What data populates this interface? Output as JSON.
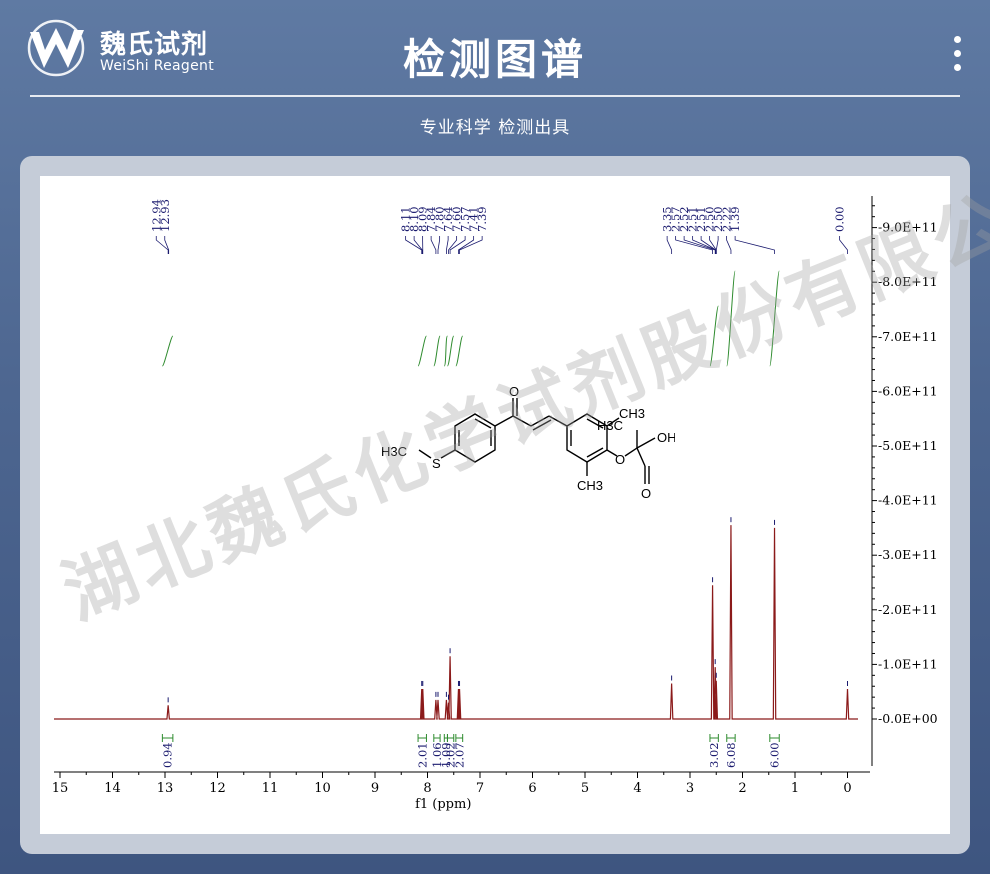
{
  "brand": {
    "name_cn": "魏氏试剂",
    "name_en": "WeiShi Reagent"
  },
  "header": {
    "title": "检测图谱",
    "subtitle": "专业科学  检测出具"
  },
  "watermark": "湖北魏氏化学试剂股份有限公司",
  "colors": {
    "spectrum": "#8b1a1a",
    "integral": "#2e8b2e",
    "peak_label": "#1a1a6e",
    "header_bg": "#4d6690"
  },
  "molecule_labels": {
    "h3c_s": "H3C",
    "s": "S",
    "o_ketone": "O",
    "h3c": "H3C",
    "ch3_top": "CH3",
    "ch3_bottom": "CH3",
    "o_ether": "O",
    "oh": "OH",
    "o_acid": "O"
  },
  "chart_data": {
    "type": "line",
    "title": "",
    "xlabel": "f1 (ppm)",
    "ylabel": "",
    "xlim": [
      15,
      -0.2
    ],
    "ylim": [
      -100000000000.0,
      950000000000.0
    ],
    "x_ticks": [
      "15",
      "14",
      "13",
      "12",
      "11",
      "10",
      "9",
      "8",
      "7",
      "6",
      "5",
      "4",
      "3",
      "2",
      "1",
      "0"
    ],
    "y_ticks": [
      "0.0E+00",
      "1.0E+11",
      "2.0E+11",
      "3.0E+11",
      "4.0E+11",
      "5.0E+11",
      "6.0E+11",
      "7.0E+11",
      "8.0E+11",
      "9.0E+11"
    ],
    "peaks": [
      {
        "ppm": 12.94,
        "height": 25000000000.0
      },
      {
        "ppm": 8.11,
        "height": 55000000000.0
      },
      {
        "ppm": 8.09,
        "height": 55000000000.0
      },
      {
        "ppm": 7.84,
        "height": 35000000000.0
      },
      {
        "ppm": 7.8,
        "height": 35000000000.0
      },
      {
        "ppm": 7.64,
        "height": 35000000000.0
      },
      {
        "ppm": 7.6,
        "height": 30000000000.0
      },
      {
        "ppm": 7.57,
        "height": 115000000000.0
      },
      {
        "ppm": 7.41,
        "height": 55000000000.0
      },
      {
        "ppm": 7.39,
        "height": 55000000000.0
      },
      {
        "ppm": 3.35,
        "height": 65000000000.0
      },
      {
        "ppm": 2.57,
        "height": 245000000000.0
      },
      {
        "ppm": 2.52,
        "height": 95000000000.0
      },
      {
        "ppm": 2.5,
        "height": 70000000000.0
      },
      {
        "ppm": 2.22,
        "height": 355000000000.0
      },
      {
        "ppm": 1.39,
        "height": 350000000000.0
      },
      {
        "ppm": 0.0,
        "height": 55000000000.0
      }
    ],
    "peak_label_groups": [
      {
        "labels": [
          "12.94",
          "12.93"
        ]
      },
      {
        "labels": [
          "8.11",
          "8.10",
          "8.09",
          "7.84",
          "7.80",
          "7.64",
          "7.60",
          "7.57",
          "7.41",
          "7.39"
        ]
      },
      {
        "labels": [
          "3.35",
          "2.57",
          "2.52",
          "2.51",
          "2.51",
          "2.50",
          "2.50",
          "2.22",
          "1.39"
        ]
      },
      {
        "labels": [
          "0.00"
        ]
      }
    ],
    "integrals": [
      {
        "from": 13.05,
        "to": 12.85,
        "value": "0.94"
      },
      {
        "from": 8.18,
        "to": 8.02,
        "value": "2.01"
      },
      {
        "from": 7.88,
        "to": 7.76,
        "value": "1.06"
      },
      {
        "from": 7.68,
        "to": 7.62,
        "value": "1.09"
      },
      {
        "from": 7.62,
        "to": 7.5,
        "value": "2.02"
      },
      {
        "from": 7.46,
        "to": 7.33,
        "value": "2.07"
      },
      {
        "from": 2.62,
        "to": 2.46,
        "value": "3.02"
      },
      {
        "from": 2.3,
        "to": 2.14,
        "value": "6.08"
      },
      {
        "from": 1.48,
        "to": 1.3,
        "value": "6.00"
      }
    ]
  }
}
